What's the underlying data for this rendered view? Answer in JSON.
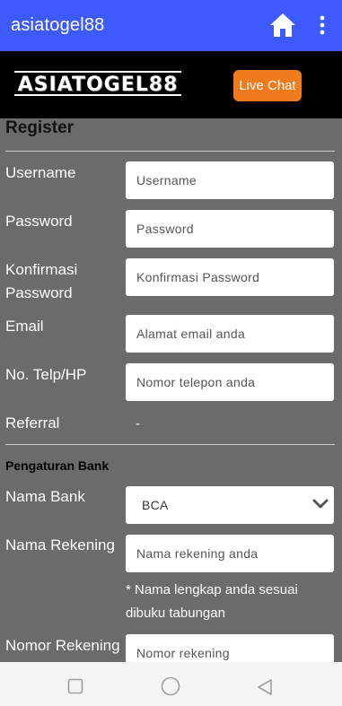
{
  "app": {
    "title": "asiatogel88"
  },
  "brand": {
    "logo_text": "ASIATOGEL88",
    "live_chat_label": "Live Chat"
  },
  "form": {
    "heading": "Register",
    "fields": [
      {
        "label": "Username",
        "placeholder": "Username"
      },
      {
        "label": "Password",
        "placeholder": "Password"
      },
      {
        "label": "Konfirmasi Password",
        "placeholder": "Konfirmasi Password"
      },
      {
        "label": "Email",
        "placeholder": "Alamat email anda"
      },
      {
        "label": "No. Telp/HP",
        "placeholder": "Nomor telepon anda"
      }
    ],
    "referral": {
      "label": "Referral",
      "value": "-"
    },
    "bank_section": "Pengaturan Bank",
    "bank_name": {
      "label": "Nama Bank",
      "value": "BCA"
    },
    "account_name": {
      "label": "Nama Rekening",
      "placeholder": "Nama rekening anda",
      "note": "* Nama lengkap anda sesuai dibuku tabungan"
    },
    "account_number": {
      "label": "Nomor Rekening",
      "placeholder": "Nomor rekening"
    }
  },
  "colors": {
    "appbar": "#3d5afe",
    "live_chat": "#f07b1d",
    "form_bg": "#6b6b6b"
  },
  "icons": {
    "home": "home-icon",
    "more": "more-vert-icon",
    "nav": [
      "square-icon",
      "circle-icon",
      "back-triangle-icon"
    ]
  }
}
